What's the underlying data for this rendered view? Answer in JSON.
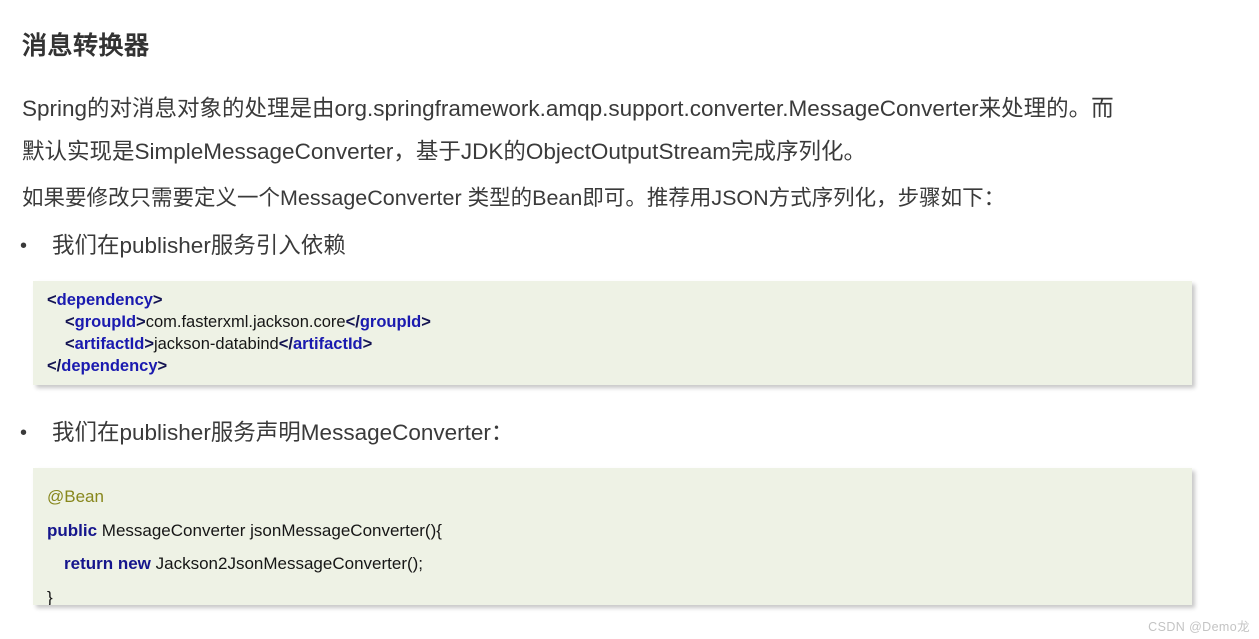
{
  "title": "消息转换器",
  "paragraphs": [
    "Spring的对消息对象的处理是由org.springframework.amqp.support.converter.MessageConverter来处理的。而",
    "默认实现是SimpleMessageConverter，基于JDK的ObjectOutputStream完成序列化。",
    "如果要修改只需要定义一个MessageConverter 类型的Bean即可。推荐用JSON方式序列化，步骤如下："
  ],
  "bullets": [
    {
      "marker": "•",
      "text": "我们在publisher服务引入依赖"
    },
    {
      "marker": "•",
      "text": "我们在publisher服务声明MessageConverter："
    }
  ],
  "code_xml": {
    "language": "xml",
    "lines": [
      {
        "indent": 0,
        "tokens": [
          {
            "type": "bracket",
            "text": "<"
          },
          {
            "type": "tagname",
            "text": "dependency"
          },
          {
            "type": "bracket",
            "text": ">"
          }
        ]
      },
      {
        "indent": 1,
        "tokens": [
          {
            "type": "bracket",
            "text": "<"
          },
          {
            "type": "tagname",
            "text": "groupId"
          },
          {
            "type": "bracket",
            "text": ">"
          },
          {
            "type": "plain",
            "text": "com.fasterxml.jackson.core"
          },
          {
            "type": "bracket",
            "text": "</"
          },
          {
            "type": "tagname",
            "text": "groupId"
          },
          {
            "type": "bracket",
            "text": ">"
          }
        ]
      },
      {
        "indent": 1,
        "tokens": [
          {
            "type": "bracket",
            "text": "<"
          },
          {
            "type": "tagname",
            "text": "artifactId"
          },
          {
            "type": "bracket",
            "text": ">"
          },
          {
            "type": "plain",
            "text": "jackson-databind"
          },
          {
            "type": "bracket",
            "text": "</"
          },
          {
            "type": "tagname",
            "text": "artifactId"
          },
          {
            "type": "bracket",
            "text": ">"
          }
        ]
      },
      {
        "indent": 0,
        "tokens": [
          {
            "type": "bracket",
            "text": "</"
          },
          {
            "type": "tagname",
            "text": "dependency"
          },
          {
            "type": "bracket",
            "text": ">"
          }
        ]
      }
    ]
  },
  "code_java": {
    "language": "java",
    "lines": [
      {
        "indent": 0,
        "tokens": [
          {
            "type": "anno",
            "text": "@Bean"
          }
        ]
      },
      {
        "indent": 0,
        "tokens": [
          {
            "type": "kw",
            "text": "public"
          },
          {
            "type": "plain",
            "text": " MessageConverter jsonMessageConverter(){"
          }
        ]
      },
      {
        "indent": 1,
        "tokens": [
          {
            "type": "kw",
            "text": "return new"
          },
          {
            "type": "plain",
            "text": " Jackson2JsonMessageConverter();"
          }
        ]
      },
      {
        "indent": 0,
        "tokens": [
          {
            "type": "plain",
            "text": "}"
          }
        ]
      }
    ]
  },
  "watermark": "CSDN @Demo龙",
  "colors": {
    "code_background": "#eef2e5",
    "tag_name": "#1a1aaf",
    "bracket": "#141452",
    "keyword": "#15158c",
    "annotation": "#87871c",
    "body_text": "#3a3a3a",
    "title_text": "#333333",
    "watermark": "#c4c4c4"
  }
}
